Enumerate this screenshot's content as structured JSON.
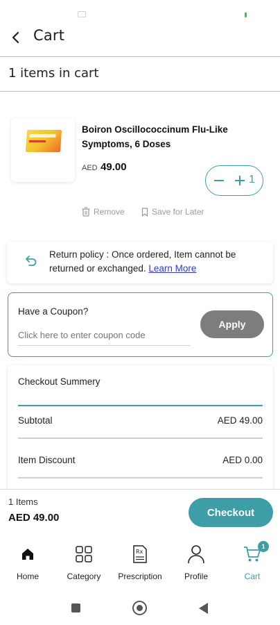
{
  "header": {
    "title": "Cart"
  },
  "cart": {
    "items_count_label": "1 items in cart"
  },
  "product": {
    "name": "Boiron Oscillococcinum Flu-Like Symptoms, 6 Doses",
    "currency": "AED",
    "price": "49.00",
    "quantity": "1",
    "remove_label": "Remove",
    "save_later_label": "Save for Later"
  },
  "policy": {
    "text": "Return policy : Once ordered, Item cannot be returned or exchanged.",
    "link": "Learn More"
  },
  "coupon": {
    "label": "Have a Coupon?",
    "placeholder": "Click here to enter coupon code",
    "apply_label": "Apply"
  },
  "summary": {
    "title": "Checkout Summery",
    "rows": [
      {
        "label": "Subtotal",
        "value": "AED 49.00"
      },
      {
        "label": "Item Discount",
        "value": "AED 0.00"
      }
    ]
  },
  "checkout_bar": {
    "items": "1 Items",
    "total": "AED 49.00",
    "checkout_label": "Checkout"
  },
  "nav": {
    "tabs": [
      {
        "label": "Home",
        "icon": "home-icon"
      },
      {
        "label": "Category",
        "icon": "category-icon"
      },
      {
        "label": "Prescription",
        "icon": "prescription-icon"
      },
      {
        "label": "Profile",
        "icon": "profile-icon"
      },
      {
        "label": "Cart",
        "icon": "cart-icon",
        "badge": "1",
        "active": true
      }
    ]
  },
  "colors": {
    "accent": "#3d9ea8",
    "link": "#2b3bd6",
    "apply_button": "#7d7d7d"
  }
}
